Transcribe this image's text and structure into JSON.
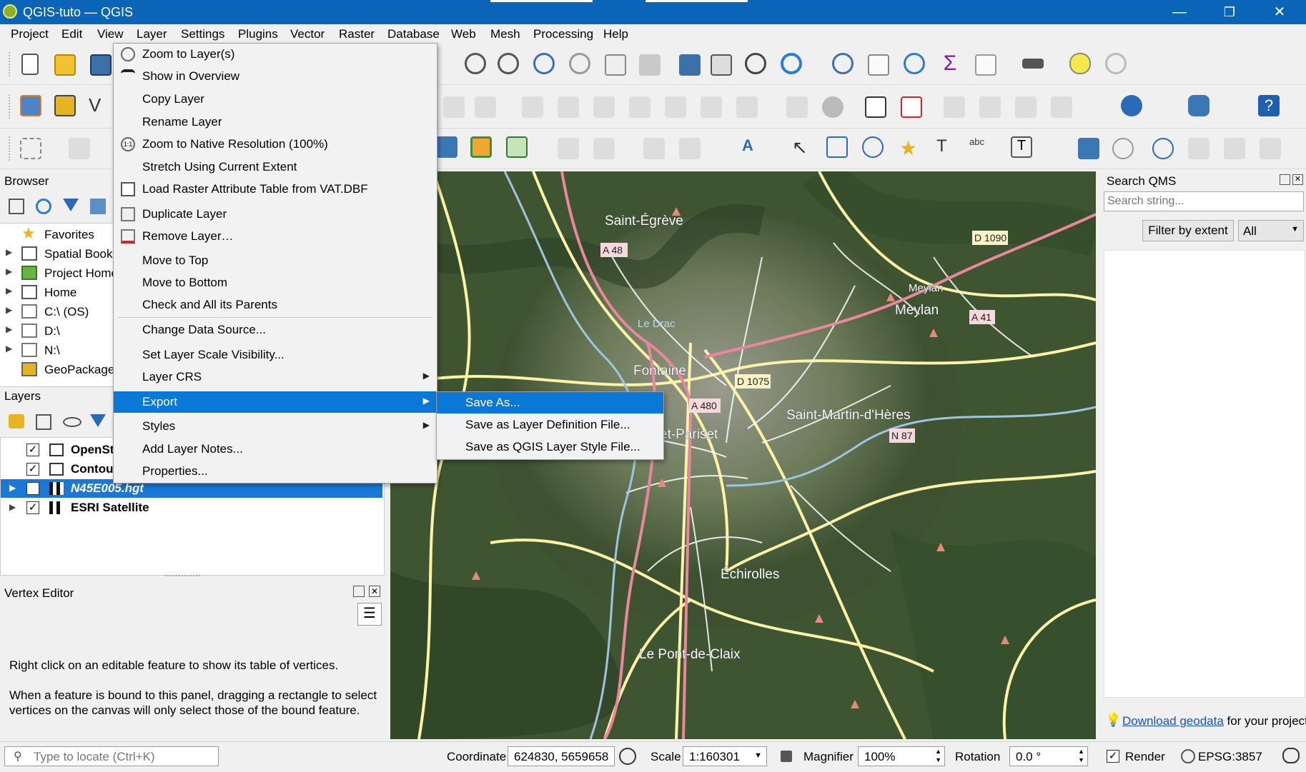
{
  "window": {
    "title": "QGIS-tuto — QGIS",
    "minimize": "—",
    "restore": "❐",
    "close": "✕"
  },
  "menubar": [
    "Project",
    "Edit",
    "View",
    "Layer",
    "Settings",
    "Plugins",
    "Vector",
    "Raster",
    "Database",
    "Web",
    "Mesh",
    "Processing",
    "Help"
  ],
  "browser": {
    "title": "Browser",
    "items": [
      {
        "label": "Favorites",
        "icon": "star-icon",
        "expandable": false
      },
      {
        "label": "Spatial Bookm",
        "icon": "bookmark-icon",
        "expandable": true
      },
      {
        "label": "Project Home",
        "icon": "project-home-icon",
        "expandable": true
      },
      {
        "label": "Home",
        "icon": "home-icon",
        "expandable": true
      },
      {
        "label": "C:\\ (OS)",
        "icon": "folder-icon",
        "expandable": true
      },
      {
        "label": "D:\\",
        "icon": "folder-icon",
        "expandable": true
      },
      {
        "label": "N:\\",
        "icon": "folder-icon",
        "expandable": true
      },
      {
        "label": "GeoPackage",
        "icon": "geopackage-icon",
        "expandable": false
      }
    ]
  },
  "layers": {
    "title": "Layers",
    "items": [
      {
        "label": "OpenSt",
        "checked": true,
        "icon": "raster-grid-icon",
        "selected": false
      },
      {
        "label": "Contou",
        "checked": true,
        "icon": "raster-grid-icon",
        "selected": false
      },
      {
        "label": "N45E005.hgt",
        "checked": false,
        "icon": "raster-checker-icon",
        "selected": true
      },
      {
        "label": "ESRI Satellite",
        "checked": true,
        "icon": "raster-checker-icon",
        "selected": false
      }
    ]
  },
  "vertex_editor": {
    "title": "Vertex Editor",
    "text1": "Right click on an editable feature to show its table of vertices.",
    "text2a": "When a feature is bound to this panel, dragging a rectangle to select",
    "text2b": "vertices on the canvas will only select those of the bound feature."
  },
  "context_menu": {
    "items": [
      {
        "label": "Zoom to Layer(s)",
        "icon": "zoom-layer-icon"
      },
      {
        "label": "Show in Overview",
        "icon": "overview-icon"
      },
      {
        "label": "Copy Layer",
        "icon": ""
      },
      {
        "label": "Rename Layer",
        "icon": ""
      },
      {
        "label": "Zoom to Native Resolution (100%)",
        "icon": "zoom-native-icon"
      },
      {
        "label": "Stretch Using Current Extent",
        "icon": ""
      },
      {
        "label": "Load Raster Attribute Table from VAT.DBF",
        "icon": "table-icon"
      },
      {
        "label": "Duplicate Layer",
        "icon": "duplicate-icon"
      },
      {
        "label": "Remove Layer…",
        "icon": "remove-layer-icon"
      },
      {
        "label": "Move to Top",
        "icon": ""
      },
      {
        "label": "Move to Bottom",
        "icon": ""
      },
      {
        "label": "Check and All its Parents",
        "icon": ""
      },
      {
        "label": "Change Data Source...",
        "icon": ""
      },
      {
        "label": "Set Layer Scale Visibility...",
        "icon": ""
      },
      {
        "label": "Layer CRS",
        "icon": ""
      },
      {
        "label": "Export",
        "icon": ""
      },
      {
        "label": "Styles",
        "icon": ""
      },
      {
        "label": "Add Layer Notes...",
        "icon": ""
      },
      {
        "label": "Properties...",
        "icon": ""
      }
    ],
    "highlighted": "Export"
  },
  "export_submenu": {
    "items": [
      "Save As...",
      "Save as Layer Definition File...",
      "Save as QGIS Layer Style File..."
    ],
    "highlighted": "Save As..."
  },
  "map": {
    "places": [
      "Saint-Égrève",
      "Meylan",
      "Meylan",
      "Fontaine",
      "Saint-Martin-d'Hères",
      "et-Pariset",
      "Échirolles",
      "Le Pont-de-Claix",
      "Le Drac"
    ],
    "roads": [
      "A 48",
      "D 1090",
      "A 41",
      "D 1075",
      "A 480",
      "N 87"
    ]
  },
  "search_qms": {
    "title": "Search QMS",
    "placeholder": "Search string...",
    "filter_button": "Filter by extent",
    "filter_value": "All",
    "download_link": "Download geodata",
    "download_suffix": " for your project"
  },
  "statusbar": {
    "locate_placeholder": "Type to locate (Ctrl+K)",
    "coordinate_label": "Coordinate",
    "coordinate_value": "624830, 5659658",
    "scale_label": "Scale",
    "scale_value": "1:160301",
    "magnifier_label": "Magnifier",
    "magnifier_value": "100%",
    "rotation_label": "Rotation",
    "rotation_value": "0.0 °",
    "render_label": "Render",
    "crs_value": "EPSG:3857"
  },
  "colors": {
    "titlebar": "#0a65b8",
    "highlight": "#0a78d7",
    "layer_selected": "#1b78d7"
  }
}
